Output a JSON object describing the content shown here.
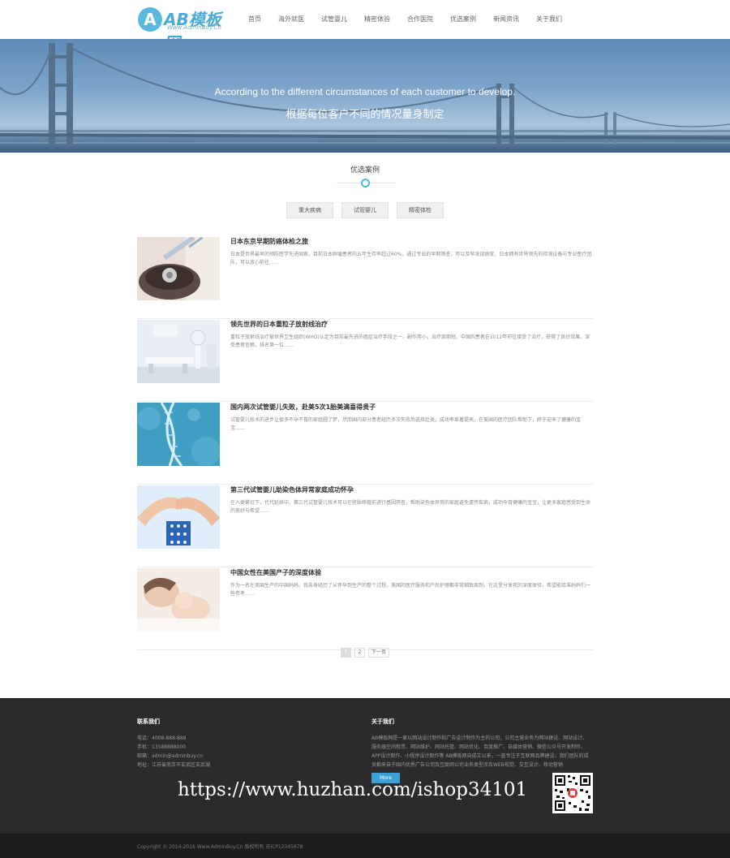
{
  "brand": {
    "logo_letter": "A",
    "logo_text": "AB模板网",
    "logo_sub": "Www.AdminBuy.Cn",
    "accent": "#4aa9d6"
  },
  "nav": {
    "items": [
      "首页",
      "海外就医",
      "试管婴儿",
      "精密体验",
      "合作医院",
      "优选案例",
      "新闻资讯",
      "关于我们"
    ]
  },
  "banner": {
    "en": "According to the different circumstances of each customer to develop.",
    "cn": "根据每位客户不同的情况量身制定"
  },
  "section": {
    "title": "优选案例"
  },
  "filters": [
    "重大疾病",
    "试管婴儿",
    "精密体检"
  ],
  "articles": [
    {
      "title": "日本东京早期防癌体检之旅",
      "desc": "日本是世界最早的预防医学先进国家，目前日本肿瘤患者的五年生存率超过60%，通过专业的早期筛查，可以及早发现病变，日本拥有世界领先的检测设备与专业医疗团队，可以放心前往……",
      "thumb": "medical-device"
    },
    {
      "title": "领先世界的日本重粒子放射线治疗",
      "desc": "重粒子放射线治疗被世界卫生组织(WHO)认定为目前最先进的癌症治疗手段之一，副作用小，治疗周期短。中国的患者在2012年前往接受了治疗，获得了良好效果，深受患者信赖，排名第一位……",
      "thumb": "mri-room"
    },
    {
      "title": "国内两次试管婴儿失败，赴美5次1胎美满喜得贵子",
      "desc": "试管婴儿技术的进步让很多不孕不育的家庭圆了梦，然而国内部分患者经历多次失败后选择赴美，成功率显著提高，在美国的医疗团队帮助下，终于迎来了健康的宝宝……",
      "thumb": "dna"
    },
    {
      "title": "第三代试管婴儿助染色体异常家庭成功怀孕",
      "desc": "在人类繁衍下，代代延续中，第三代试管婴儿技术可以在胚胎移植前进行基因筛查，帮助染色体异常的家庭避免遗传疾病，成功孕育健康的宝宝，让更多家庭感受到生命的美好与希望……",
      "thumb": "hands-family"
    },
    {
      "title": "中国女性在美国产子的深度体验",
      "desc": "作为一名在美国生产的中国妈妈，我亲身经历了从怀孕到生产的整个过程，美国的医疗服务和产后护理都非常细致周到，在这里分享我的深度体验，希望能给准妈妈们一些参考……",
      "thumb": "baby"
    }
  ],
  "pagination": {
    "pages": [
      "1",
      "2"
    ],
    "next": "下一页",
    "active": "1"
  },
  "footer": {
    "contact_title": "联系我们",
    "contact_lines": [
      "电话：4008-888-888",
      "手机：13588888000",
      "邮箱：admin@adminbuy.cn",
      "地址：江苏省南京市玄武区玄武湖"
    ],
    "about_title": "关于我们",
    "about_text": "AB模板网是一家以网站设计制作和广告设计制作为主的公司，公司主营业务为网站建设、网站设计、服务器空间租赁、网站维护、网站托管、网站优化、百度推广、自媒体营销、微信公众号开发制作、APP设计制作、小程序设计制作等 AB模板网自成立以来，一直专注于互联网品牌建设，我们团队的成员都来自于国内优秀广告公司及互联网公司业务类型涉及WEB视觉、交互设计、移动营销",
    "more_label": "More",
    "watermark": "https://www.huzhan.com/ishop34101",
    "copyright": "Copyright © 2014-2016 Www.AdminBuy.Cn 版权所有   苏ICP12345678"
  }
}
